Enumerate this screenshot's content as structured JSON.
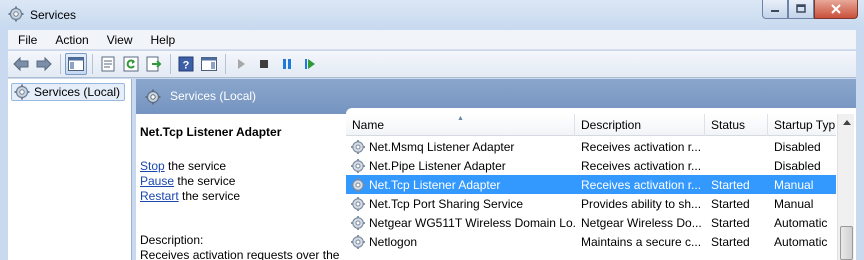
{
  "window": {
    "title": "Services"
  },
  "menu": [
    "File",
    "Action",
    "View",
    "Help"
  ],
  "toolbar": {
    "buttons": [
      "back-arrow-icon",
      "forward-arrow-icon",
      "console-tree-icon",
      "properties-icon",
      "refresh-icon",
      "export-list-icon",
      "help-icon",
      "show-hide-action-pane-icon",
      "play-icon",
      "stop-icon",
      "pause-icon",
      "restart-icon"
    ]
  },
  "tree": {
    "root_label": "Services (Local)"
  },
  "pane": {
    "title": "Services (Local)"
  },
  "detail": {
    "service_name": "Net.Tcp Listener Adapter",
    "actions": [
      {
        "link": "Stop",
        "rest": " the service"
      },
      {
        "link": "Pause",
        "rest": " the service"
      },
      {
        "link": "Restart",
        "rest": " the service"
      }
    ],
    "description_label": "Description:",
    "description_text": "Receives activation requests over the"
  },
  "columns": [
    "Name",
    "Description",
    "Status",
    "Startup Typ"
  ],
  "rows": [
    {
      "name": "Net.Msmq Listener Adapter",
      "description": "Receives activation r...",
      "status": "",
      "startup": "Disabled",
      "selected": false
    },
    {
      "name": "Net.Pipe Listener Adapter",
      "description": "Receives activation r...",
      "status": "",
      "startup": "Disabled",
      "selected": false
    },
    {
      "name": "Net.Tcp Listener Adapter",
      "description": "Receives activation r...",
      "status": "Started",
      "startup": "Manual",
      "selected": true
    },
    {
      "name": "Net.Tcp Port Sharing Service",
      "description": "Provides ability to sh...",
      "status": "Started",
      "startup": "Manual",
      "selected": false
    },
    {
      "name": "Netgear WG511T Wireless Domain Lo...",
      "description": "Netgear Wireless Do...",
      "status": "Started",
      "startup": "Automatic",
      "selected": false
    },
    {
      "name": "Netlogon",
      "description": "Maintains a secure c...",
      "status": "Started",
      "startup": "Automatic",
      "selected": false
    }
  ],
  "colors": {
    "selection": "#3399ff",
    "pane_header": "#7f9dc7",
    "link": "#1a47b0"
  }
}
